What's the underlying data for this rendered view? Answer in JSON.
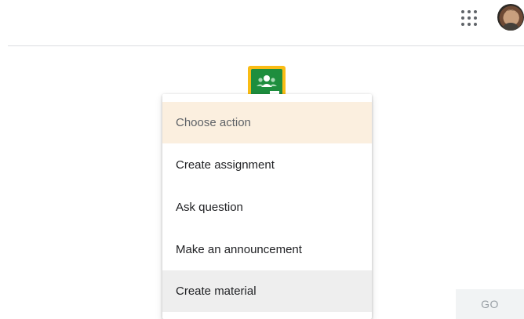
{
  "header": {
    "apps_icon": "grid-apps-icon",
    "avatar_icon": "user-avatar"
  },
  "app_logo": {
    "icon": "google-classroom-icon",
    "colors": {
      "frame": "#f9bc15",
      "board": "#1e8e3e"
    }
  },
  "action_menu": {
    "header_label": "Choose action",
    "items": [
      {
        "label": "Create assignment"
      },
      {
        "label": "Ask question"
      },
      {
        "label": "Make an announcement"
      },
      {
        "label": "Create material",
        "highlighted": true
      }
    ],
    "colors": {
      "header_bg": "#fbefdf",
      "highlight_bg": "#eeeeee"
    }
  },
  "go_button": {
    "label": "GO",
    "disabled": true
  }
}
